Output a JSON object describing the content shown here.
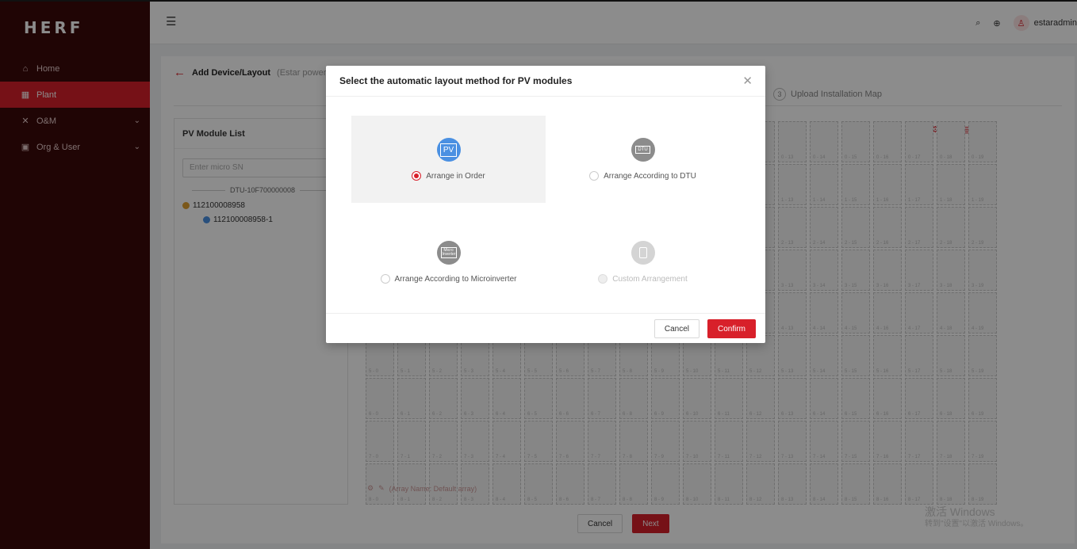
{
  "colors": {
    "accent": "#d8202a",
    "sidebar_bg": "#3b0a0a",
    "pv_blue": "#4a90e2",
    "icon_gray": "#8c8c8c"
  },
  "brand": {
    "logo": "HERF"
  },
  "sidebar": {
    "items": [
      {
        "label": "Home",
        "icon": "home-icon",
        "active": false
      },
      {
        "label": "Plant",
        "icon": "grid-icon",
        "active": true
      },
      {
        "label": "O&M",
        "icon": "tools-icon",
        "active": false
      },
      {
        "label": "Org & User",
        "icon": "user-icon",
        "active": false
      }
    ]
  },
  "header": {
    "username": "estaradmin"
  },
  "page": {
    "title": "Add Device/Layout",
    "subtitle": "(Estar power sta",
    "step_number": "3",
    "step_label": "Upload Installation Map"
  },
  "left_panel": {
    "title": "PV Module List",
    "search_placeholder": "Enter micro SN",
    "dtu": "DTU-10F700000008",
    "micro": "112100008958",
    "module": "112100008958-1"
  },
  "grid": {
    "rows": 9,
    "cols": 20,
    "array_name": "(Array Name: Default array)"
  },
  "footer": {
    "cancel": "Cancel",
    "next": "Next"
  },
  "modal": {
    "title": "Select the automatic layout method for PV modules",
    "options": [
      {
        "label": "Arrange in Order",
        "icon": "pv-icon",
        "icon_text": "PV",
        "selected": true,
        "disabled": false
      },
      {
        "label": "Arrange According to DTU",
        "icon": "dtu-icon",
        "icon_text": "DTU",
        "selected": false,
        "disabled": false
      },
      {
        "label": "Arrange According to Microinverter",
        "icon": "microinverter-icon",
        "icon_text": "Micro Inverter",
        "selected": false,
        "disabled": false
      },
      {
        "label": "Custom Arrangement",
        "icon": "custom-arrangement-icon",
        "icon_text": "",
        "selected": false,
        "disabled": true
      }
    ],
    "cancel": "Cancel",
    "confirm": "Confirm"
  },
  "watermark": {
    "line1": "激活 Windows",
    "line2": "转到\"设置\"以激活 Windows。"
  }
}
